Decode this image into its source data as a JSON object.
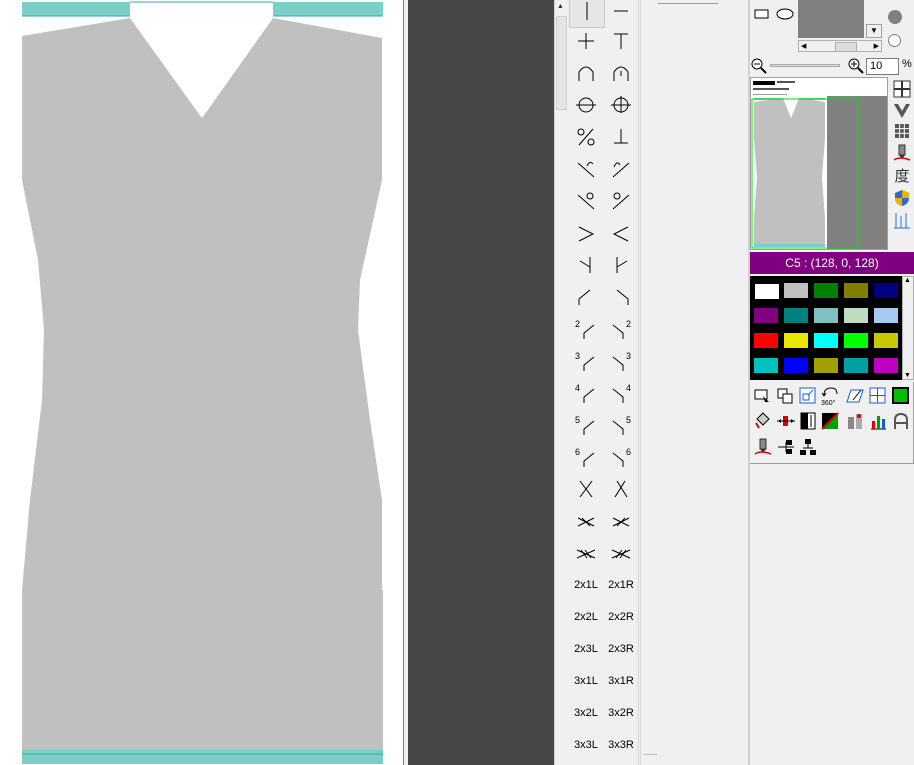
{
  "zoom": {
    "value": "10",
    "unit": "%"
  },
  "color_info": {
    "title": "C5 : (128, 0, 128)"
  },
  "colors": {
    "canvas_bg": "#ffffff",
    "garment": "#c0c0c0",
    "rib_teal": "#7ccfc8",
    "dark_panel": "#474747",
    "selected_color": "#800080"
  },
  "palette": [
    [
      "#ffffff",
      "#c0c0c0",
      "#008000",
      "#808000",
      "#000080"
    ],
    [
      "#800080",
      "#008080",
      "#80c0c0",
      "#c0dcc0",
      "#a6caf0"
    ],
    [
      "#ff0000",
      "#e8e800",
      "#00ffff",
      "#00ff00",
      "#c8c800"
    ],
    [
      "#00c0c0",
      "#0000ff",
      "#a0a000",
      "#00a0a0",
      "#c000c0"
    ]
  ],
  "stitch_labels": {
    "r2_left": "2",
    "r2_right": "2",
    "r3_left": "3",
    "r3_right": "3",
    "r4_left": "4",
    "r4_right": "4",
    "r5_left": "5",
    "r5_right": "5",
    "r6_left": "6",
    "r6_right": "6",
    "x2x1l": "2x1L",
    "x2x1r": "2x1R",
    "x2x2l": "2x2L",
    "x2x2r": "2x2R",
    "x2x3l": "2x3L",
    "x2x3r": "2x3R",
    "x3x1l": "3x1L",
    "x3x1r": "3x1R",
    "x3x2l": "3x2L",
    "x3x2r": "3x2R",
    "x3x3l": "3x3L",
    "x3x3r": "3x3R"
  },
  "side_glyph": "度"
}
